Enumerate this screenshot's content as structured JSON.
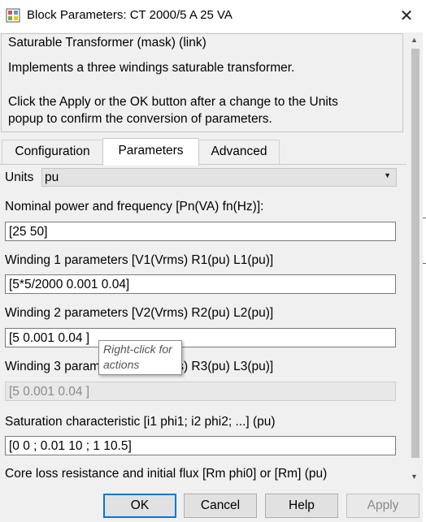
{
  "window": {
    "title": "Block Parameters: CT 2000/5 A 25 VA",
    "close_glyph": "✕"
  },
  "mask": {
    "title": "Saturable Transformer (mask) (link)",
    "description_lines": [
      "Implements a three windings saturable transformer.",
      "Click the Apply or the OK button after a change to the Units",
      "popup to confirm the conversion of parameters."
    ]
  },
  "tabs": [
    {
      "label": "Configuration",
      "active": false
    },
    {
      "label": "Parameters",
      "active": true
    },
    {
      "label": "Advanced",
      "active": false
    }
  ],
  "units": {
    "label": "Units",
    "value": "pu"
  },
  "params": [
    {
      "label": "Nominal power and frequency [Pn(VA) fn(Hz)]:",
      "value": "[25 50]",
      "enabled": true
    },
    {
      "label": "Winding 1 parameters [V1(Vrms) R1(pu) L1(pu)]",
      "value": "[5*5/2000 0.001 0.04]",
      "enabled": true
    },
    {
      "label": "Winding 2 parameters [V2(Vrms) R2(pu) L2(pu)]",
      "value": "[5 0.001 0.04 ]",
      "enabled": true
    },
    {
      "label": "Winding 3 parameters [V3(Vrms) R3(pu) L3(pu)]",
      "value": "[5 0.001 0.04 ]",
      "enabled": false
    },
    {
      "label": "Saturation characteristic [i1 phi1; i2 phi2; ...] (pu)",
      "value": "[0 0 ; 0.01 10 ; 1 10.5]",
      "enabled": true
    },
    {
      "label": "Core loss resistance and initial flux [Rm phi0] or [Rm] (pu)",
      "value": "",
      "enabled": true
    }
  ],
  "tooltip": {
    "lines": [
      "Right-click for",
      "actions"
    ]
  },
  "buttons": {
    "ok": "OK",
    "cancel": "Cancel",
    "help": "Help",
    "apply": "Apply"
  },
  "colors": {
    "focus_border": "#0078d7",
    "disabled_text": "#8a8a8a"
  }
}
